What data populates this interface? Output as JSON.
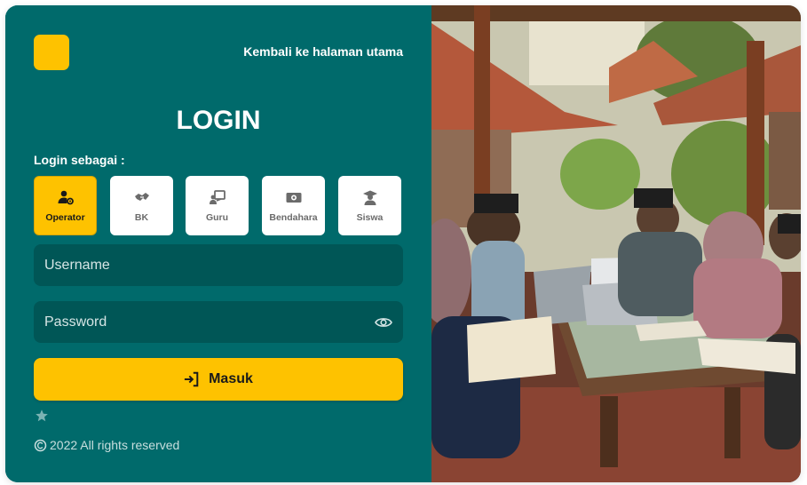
{
  "header": {
    "back_link": "Kembali ke halaman utama"
  },
  "login": {
    "title": "LOGIN",
    "role_label": "Login sebagai :"
  },
  "roles": [
    {
      "label": "Operator",
      "icon": "user-gear-icon",
      "selected": true
    },
    {
      "label": "BK",
      "icon": "handshake-icon",
      "selected": false
    },
    {
      "label": "Guru",
      "icon": "teacher-board-icon",
      "selected": false
    },
    {
      "label": "Bendahara",
      "icon": "money-icon",
      "selected": false
    },
    {
      "label": "Siswa",
      "icon": "graduate-icon",
      "selected": false
    }
  ],
  "form": {
    "username_placeholder": "Username",
    "password_placeholder": "Password",
    "submit_label": "Masuk"
  },
  "footer": {
    "copyright": "2022 All rights reserved"
  },
  "colors": {
    "panel": "#006a6b",
    "field": "#005656",
    "accent": "#fec200"
  }
}
